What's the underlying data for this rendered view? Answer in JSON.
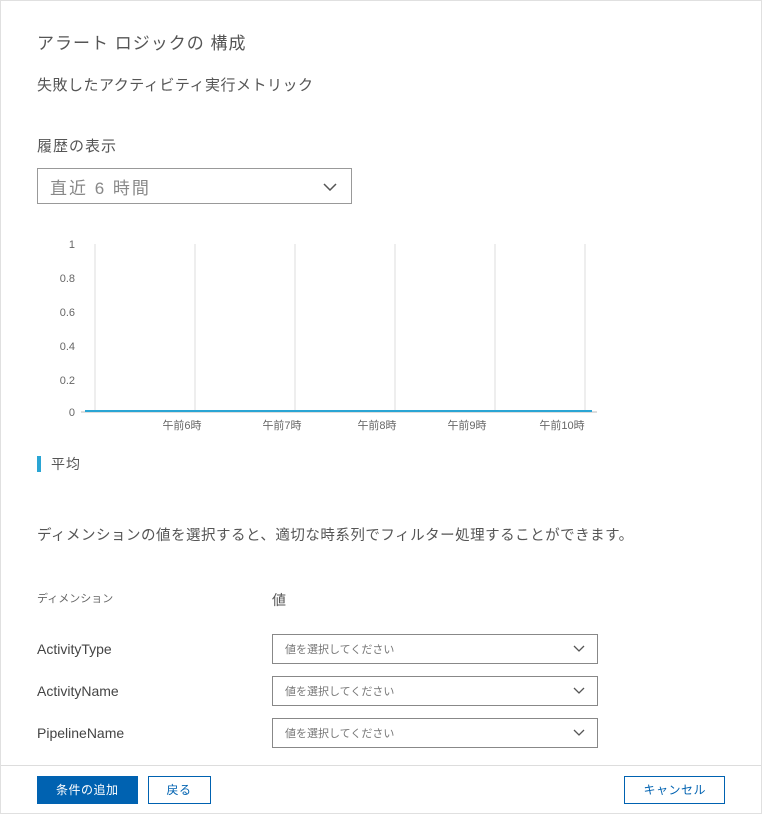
{
  "page": {
    "title": "アラート ロジックの 構成",
    "subtitle": "失敗したアクティビティ実行メトリック"
  },
  "history": {
    "label": "履歴の表示",
    "selected": "直近 6 時間"
  },
  "chart_data": {
    "type": "line",
    "title": "",
    "series": [
      {
        "name": "平均",
        "color": "#2aa5d4",
        "values": [
          0,
          0,
          0,
          0,
          0,
          0
        ]
      }
    ],
    "x_labels": [
      "",
      "午前6時",
      "午前7時",
      "午前8時",
      "午前9時",
      "午前10時"
    ],
    "y_ticks": [
      0,
      0.2,
      0.4,
      0.6,
      0.8,
      1.0
    ],
    "ylim": [
      0,
      1.0
    ],
    "xlabel": "",
    "ylabel": ""
  },
  "legend": {
    "label": "平均"
  },
  "help_text": "ディメンションの値を選択すると、適切な時系列でフィルター処理することができます。",
  "dimensions": {
    "header_dim": "ディメンション",
    "header_val": "値",
    "rows": [
      {
        "name": "ActivityType",
        "placeholder": "値を選択してください"
      },
      {
        "name": "ActivityName",
        "placeholder": "値を選択してください"
      },
      {
        "name": "PipelineName",
        "placeholder": "値を選択してください"
      }
    ]
  },
  "footer": {
    "add": "条件の追加",
    "back": "戻る",
    "cancel": "キャンセル"
  }
}
